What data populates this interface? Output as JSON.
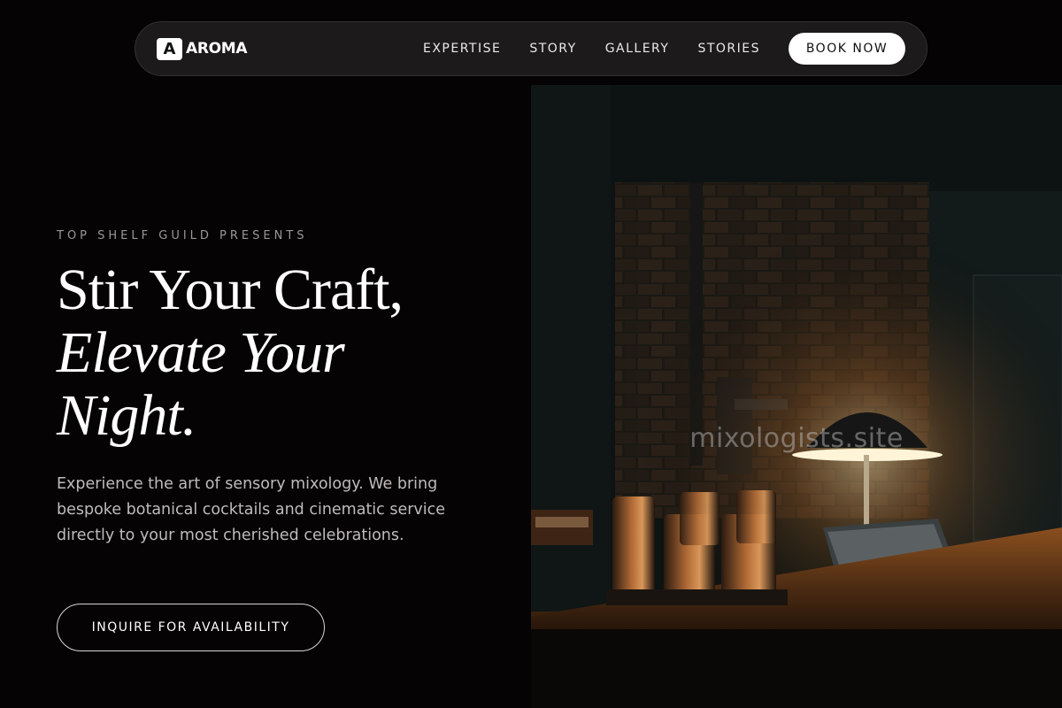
{
  "brand": {
    "logo_letter": "A",
    "name": "AROMA"
  },
  "nav": {
    "links": [
      "EXPERTISE",
      "STORY",
      "GALLERY",
      "STORIES"
    ],
    "cta_label": "BOOK NOW"
  },
  "hero": {
    "eyebrow": "TOP SHELF GUILD PRESENTS",
    "headline_line1": "Stir Your Craft,",
    "headline_line2": "Elevate Your",
    "headline_line3": "Night.",
    "intro": "Experience the art of sensory mixology. We bring bespoke botanical cocktails and cinematic service directly to your most cherished celebrations.",
    "cta_label": "INQUIRE FOR AVAILABILITY"
  },
  "image": {
    "watermark": "mixologists.site"
  },
  "colors": {
    "background": "#050304",
    "nav_background": "#1c1a1b",
    "accent_button": "#ffffff",
    "muted_text": "#9a9896",
    "body_text": "#bfbcba"
  }
}
